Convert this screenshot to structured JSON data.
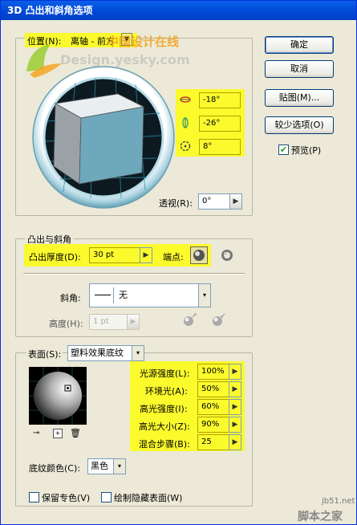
{
  "title": "3D 凸出和斜角选项",
  "watermark": {
    "line1": "中国设计在线",
    "line2": "Design.yesky.com",
    "footer_url": "jb51.net",
    "footer_name": "脚本之家"
  },
  "position": {
    "label": "位置(N):",
    "preset": "离轴 - 前方",
    "rotate_x": "-18°",
    "rotate_y": "-26°",
    "rotate_z": "8°",
    "perspective_label": "透视(R):",
    "perspective": "0°"
  },
  "buttons": {
    "ok": "确定",
    "cancel": "取消",
    "map": "贴图(M)...",
    "fewer": "较少选项(O)"
  },
  "preview": {
    "label": "预览(P)",
    "checked": true
  },
  "extrude": {
    "legend": "凸出与斜角",
    "depth_label": "凸出厚度(D):",
    "depth": "30 pt",
    "cap_label": "端点:",
    "bevel_label": "斜角:",
    "bevel": "无",
    "height_label": "高度(H):",
    "height": "1 pt"
  },
  "surface": {
    "label": "表面(S):",
    "type": "塑料效果底纹",
    "light_intensity_label": "光源强度(L):",
    "light_intensity": "100%",
    "ambient_label": "环境光(A):",
    "ambient": "50%",
    "highlight_intensity_label": "高光强度(I):",
    "highlight_intensity": "60%",
    "highlight_size_label": "高光大小(Z):",
    "highlight_size": "90%",
    "blend_steps_label": "混合步骤(B):",
    "blend_steps": "25",
    "shading_color_label": "底纹颜色(C):",
    "shading_color": "黑色",
    "preserve_spot_label": "保留专色(V)",
    "draw_hidden_label": "绘制隐藏表面(W)"
  },
  "colors": {
    "highlight": "#fafa2d",
    "cube_front": "#6ea8bc",
    "title_bar": "#0047d6"
  }
}
